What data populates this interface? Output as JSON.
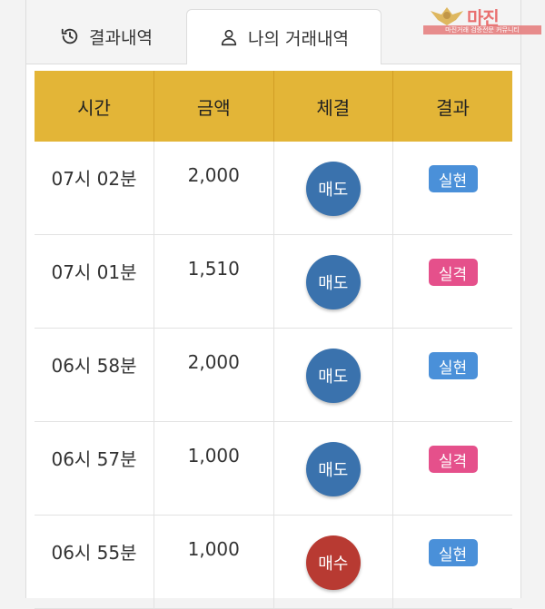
{
  "tabs": {
    "history_label": "결과내역",
    "my_trades_label": "나의 거래내역",
    "history_icon": "history-icon",
    "user_icon": "user-icon"
  },
  "table": {
    "headers": [
      "시간",
      "금액",
      "체결",
      "결과"
    ],
    "rows": [
      {
        "time": "07시 02분",
        "amount": "2,000",
        "trade": "매도",
        "trade_color": "#3a72ad",
        "result": "실현",
        "result_color": "#4a90d9"
      },
      {
        "time": "07시 01분",
        "amount": "1,510",
        "trade": "매도",
        "trade_color": "#3a72ad",
        "result": "실격",
        "result_color": "#e5508b"
      },
      {
        "time": "06시 58분",
        "amount": "2,000",
        "trade": "매도",
        "trade_color": "#3a72ad",
        "result": "실현",
        "result_color": "#4a90d9"
      },
      {
        "time": "06시 57분",
        "amount": "1,000",
        "trade": "매도",
        "trade_color": "#3a72ad",
        "result": "실격",
        "result_color": "#e5508b"
      },
      {
        "time": "06시 55분",
        "amount": "1,000",
        "trade": "매수",
        "trade_color": "#b83a32",
        "result": "실현",
        "result_color": "#4a90d9"
      }
    ]
  },
  "watermark": {
    "title": "마진",
    "subtitle": "마진거래 검증전문 커뮤니티"
  },
  "colors": {
    "header_bg": "#e3b537",
    "sell": "#3a72ad",
    "buy": "#b83a32",
    "realized": "#4a90d9",
    "failed": "#e5508b"
  }
}
